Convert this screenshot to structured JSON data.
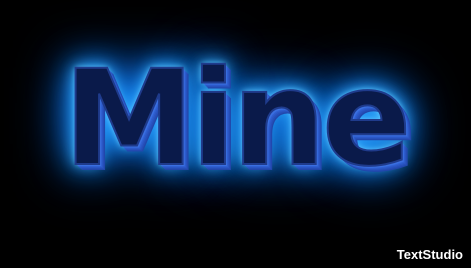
{
  "title": "Mine",
  "watermark": "TextStudio",
  "colors": {
    "background": "#000000",
    "text_fill": "#0a1a4a",
    "glow": "#1e9bff",
    "extrusion": "#3a6fe0",
    "watermark": "#ffffff"
  }
}
